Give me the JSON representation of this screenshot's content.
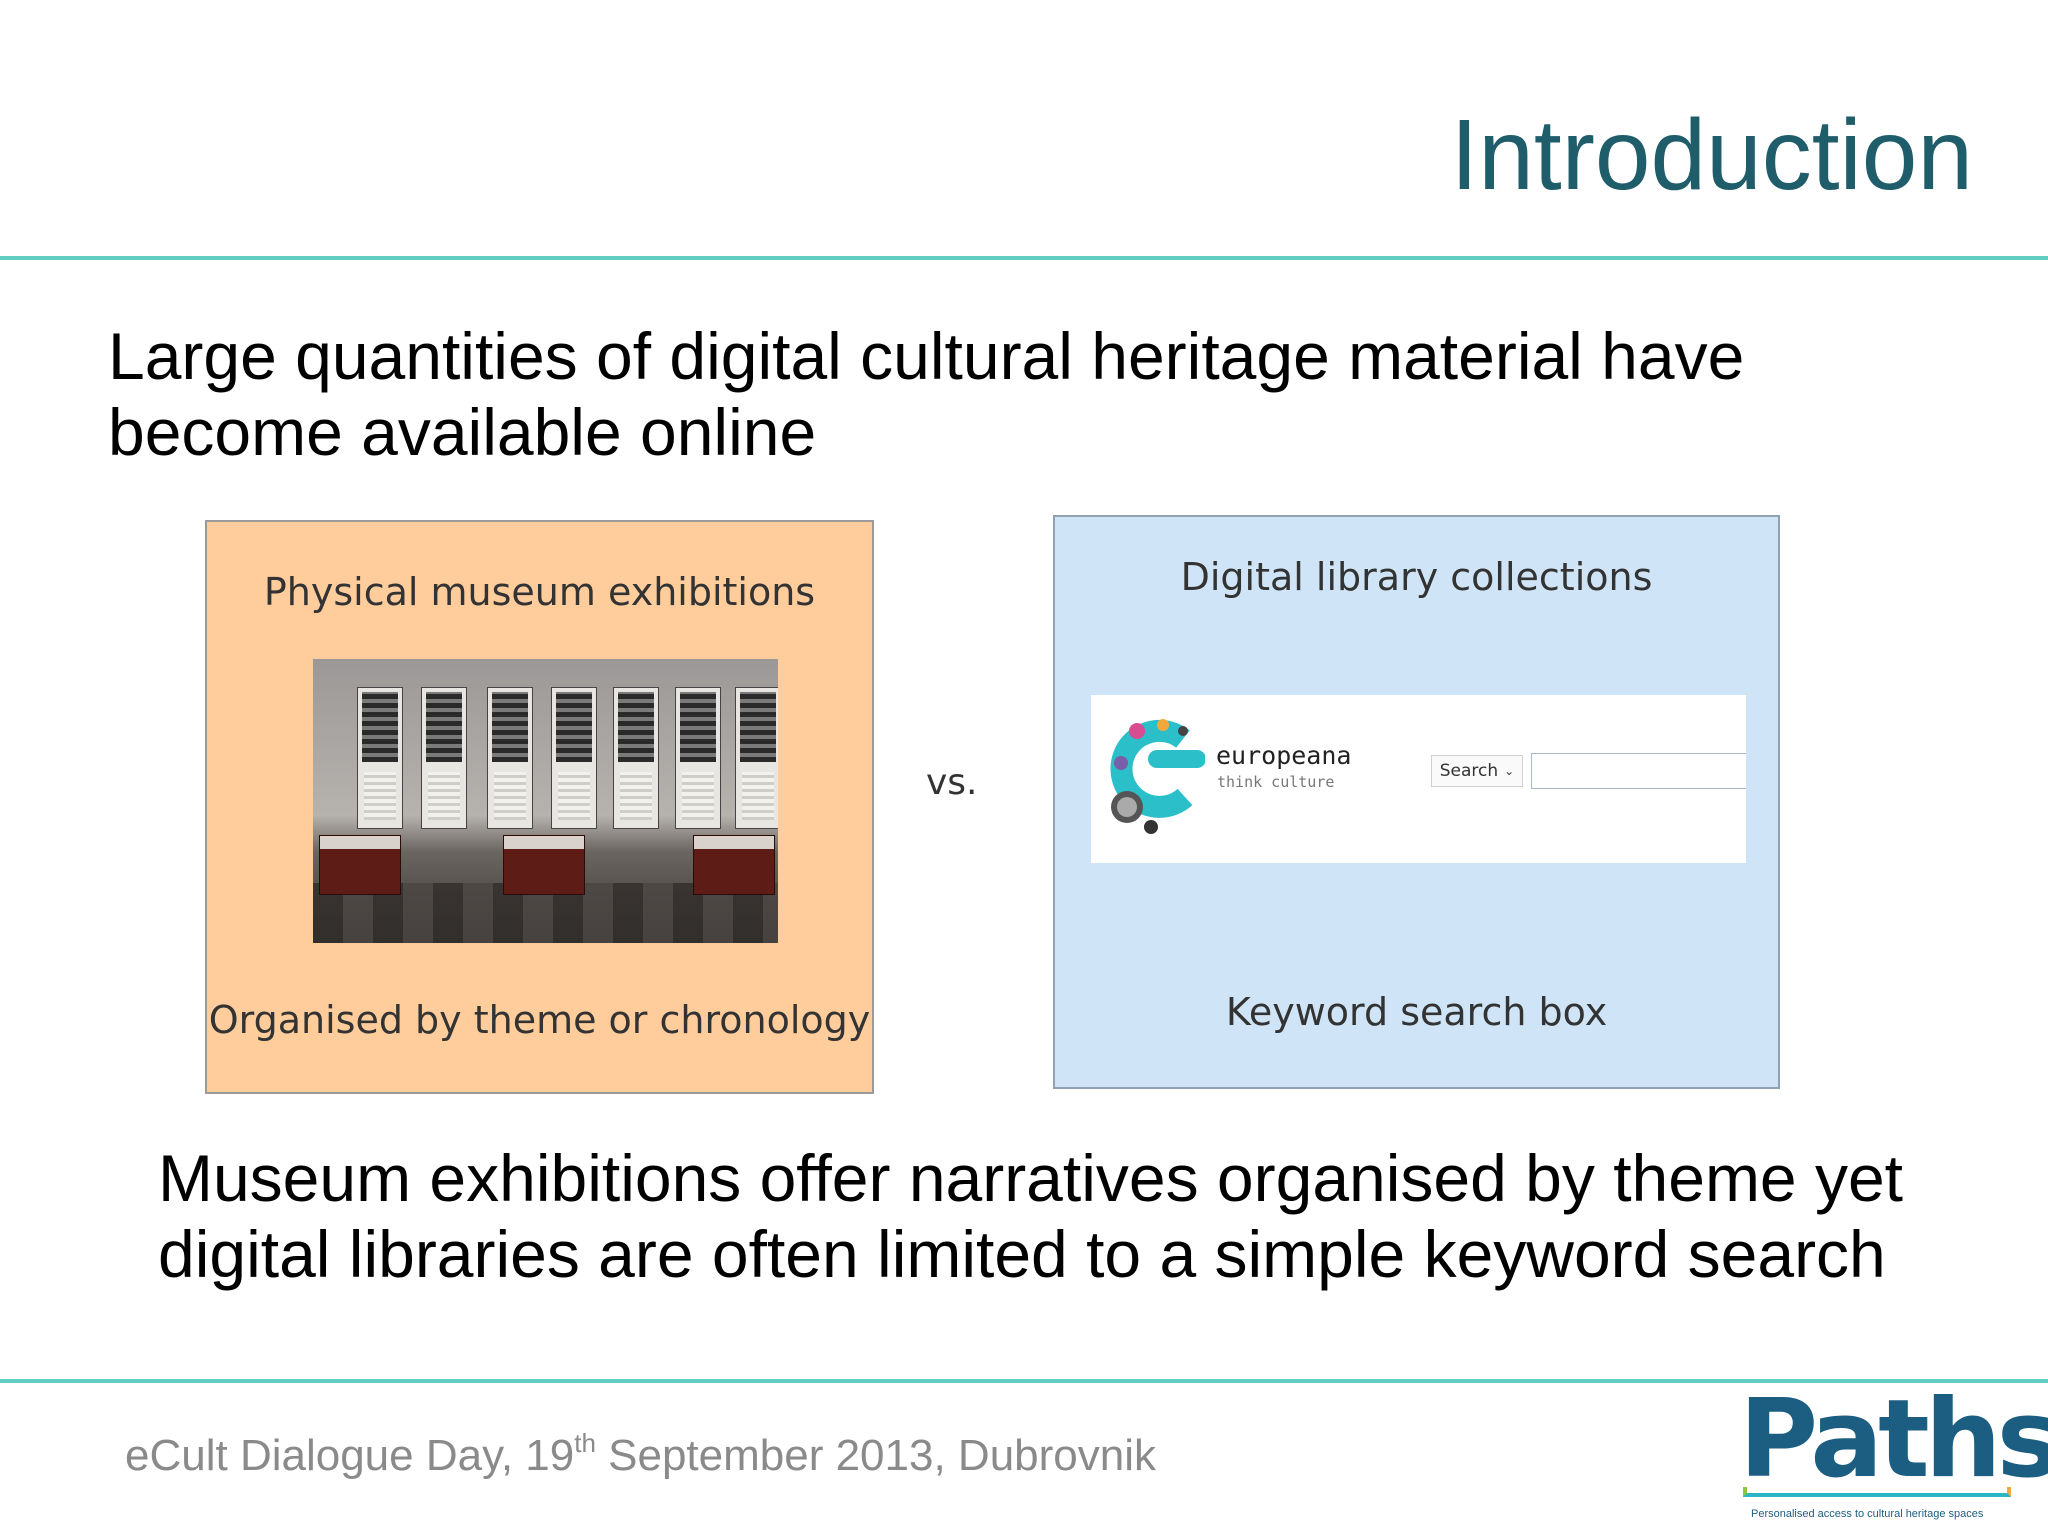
{
  "slide": {
    "title": "Introduction",
    "intro_text": "Large quantities of digital cultural heritage material have become available online",
    "summary_text": "Museum exhibitions offer narratives organised by theme yet digital libraries are often limited to a simple keyword search"
  },
  "left_panel": {
    "title": "Physical museum exhibitions",
    "caption": "Organised by theme or chronology"
  },
  "comparison_label": "vs.",
  "right_panel": {
    "title": "Digital library collections",
    "caption": "Keyword search box",
    "europeana": {
      "name": "europeana",
      "tagline": "think culture",
      "search_label": "Search",
      "search_value": ""
    }
  },
  "footer": {
    "event_prefix": "eCult Dialogue Day, 19",
    "event_suffix": "th",
    "event_rest": " September 2013, Dubrovnik"
  },
  "logo": {
    "name": "Paths",
    "tagline": "Personalised access to cultural heritage spaces"
  },
  "colors": {
    "title": "#1f5d6b",
    "rule": "#5fcfc4",
    "left_panel_bg": "#ffcc9c",
    "right_panel_bg": "#cfe5f7",
    "footer_text": "#8a8a8a",
    "logo_blue": "#1c5e82"
  }
}
